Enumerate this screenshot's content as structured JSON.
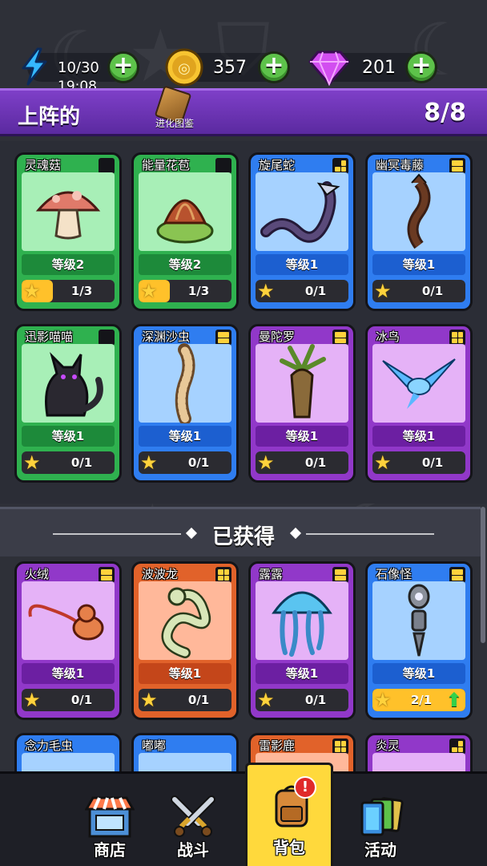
{
  "resources": {
    "energy": {
      "value": "10/30",
      "timer": "19:08",
      "icon": "lightning-icon"
    },
    "coins": {
      "value": "357",
      "icon": "coin-icon"
    },
    "gems": {
      "value": "201",
      "icon": "gem-icon"
    }
  },
  "deployed": {
    "title": "上阵的",
    "count": "8/8",
    "codex_label": "进化图鉴"
  },
  "obtained": {
    "title": "已获得"
  },
  "cards": [
    {
      "name": "灵魂菇",
      "level": "等级2",
      "progress": "1/3",
      "fill": 0.33,
      "rarity": "green",
      "tier": 1,
      "art": "mushroom"
    },
    {
      "name": "能量花苞",
      "level": "等级2",
      "progress": "1/3",
      "fill": 0.33,
      "rarity": "green",
      "tier": 1,
      "art": "bud"
    },
    {
      "name": "旋尾蛇",
      "level": "等级1",
      "progress": "0/1",
      "fill": 0,
      "rarity": "blue",
      "tier": 3,
      "art": "snake"
    },
    {
      "name": "幽冥毒藤",
      "level": "等级1",
      "progress": "0/1",
      "fill": 0,
      "rarity": "blue",
      "tier": 2,
      "art": "vine"
    },
    {
      "name": "迅影喵喵",
      "level": "等级1",
      "progress": "0/1",
      "fill": 0,
      "rarity": "green",
      "tier": 1,
      "art": "cat"
    },
    {
      "name": "深渊沙虫",
      "level": "等级1",
      "progress": "0/1",
      "fill": 0,
      "rarity": "blue",
      "tier": 2,
      "art": "worm"
    },
    {
      "name": "曼陀罗",
      "level": "等级1",
      "progress": "0/1",
      "fill": 0,
      "rarity": "purple",
      "tier": 2,
      "art": "mandrake"
    },
    {
      "name": "冰鸟",
      "level": "等级1",
      "progress": "0/1",
      "fill": 0,
      "rarity": "purple",
      "tier": 4,
      "art": "bird"
    },
    {
      "name": "火绒",
      "level": "等级1",
      "progress": "0/1",
      "fill": 0,
      "rarity": "purple",
      "tier": 2,
      "art": "firecat"
    },
    {
      "name": "波波龙",
      "level": "等级1",
      "progress": "0/1",
      "fill": 0,
      "rarity": "orange",
      "tier": 4,
      "art": "dragon"
    },
    {
      "name": "露露",
      "level": "等级1",
      "progress": "0/1",
      "fill": 0,
      "rarity": "purple",
      "tier": 2,
      "art": "jelly"
    },
    {
      "name": "石像怪",
      "level": "等级1",
      "progress": "2/1",
      "fill": 1,
      "rarity": "blue",
      "tier": 2,
      "art": "golem",
      "upgrade": true
    },
    {
      "name": "念力毛虫",
      "rarity": "blue",
      "tier": 0,
      "partial": true
    },
    {
      "name": "嘟嘟",
      "rarity": "blue",
      "tier": 0,
      "partial": true
    },
    {
      "name": "雷影鹿",
      "rarity": "orange",
      "tier": 4,
      "partial": true
    },
    {
      "name": "炎灵",
      "rarity": "purple",
      "tier": 3,
      "partial": true
    }
  ],
  "nav": [
    {
      "label": "商店",
      "icon": "shop-icon",
      "active": false
    },
    {
      "label": "战斗",
      "icon": "swords-icon",
      "active": false
    },
    {
      "label": "背包",
      "icon": "backpack-icon",
      "active": true,
      "alert": "!"
    },
    {
      "label": "活动",
      "icon": "cards-icon",
      "active": false
    }
  ],
  "colors": {
    "green": "#2fb14f",
    "blue": "#2f7df0",
    "purple": "#9138c9",
    "orange": "#e1622a",
    "header": "#7e3fc8",
    "nav_active": "#ffd93c",
    "plus": "#5dc24a"
  }
}
